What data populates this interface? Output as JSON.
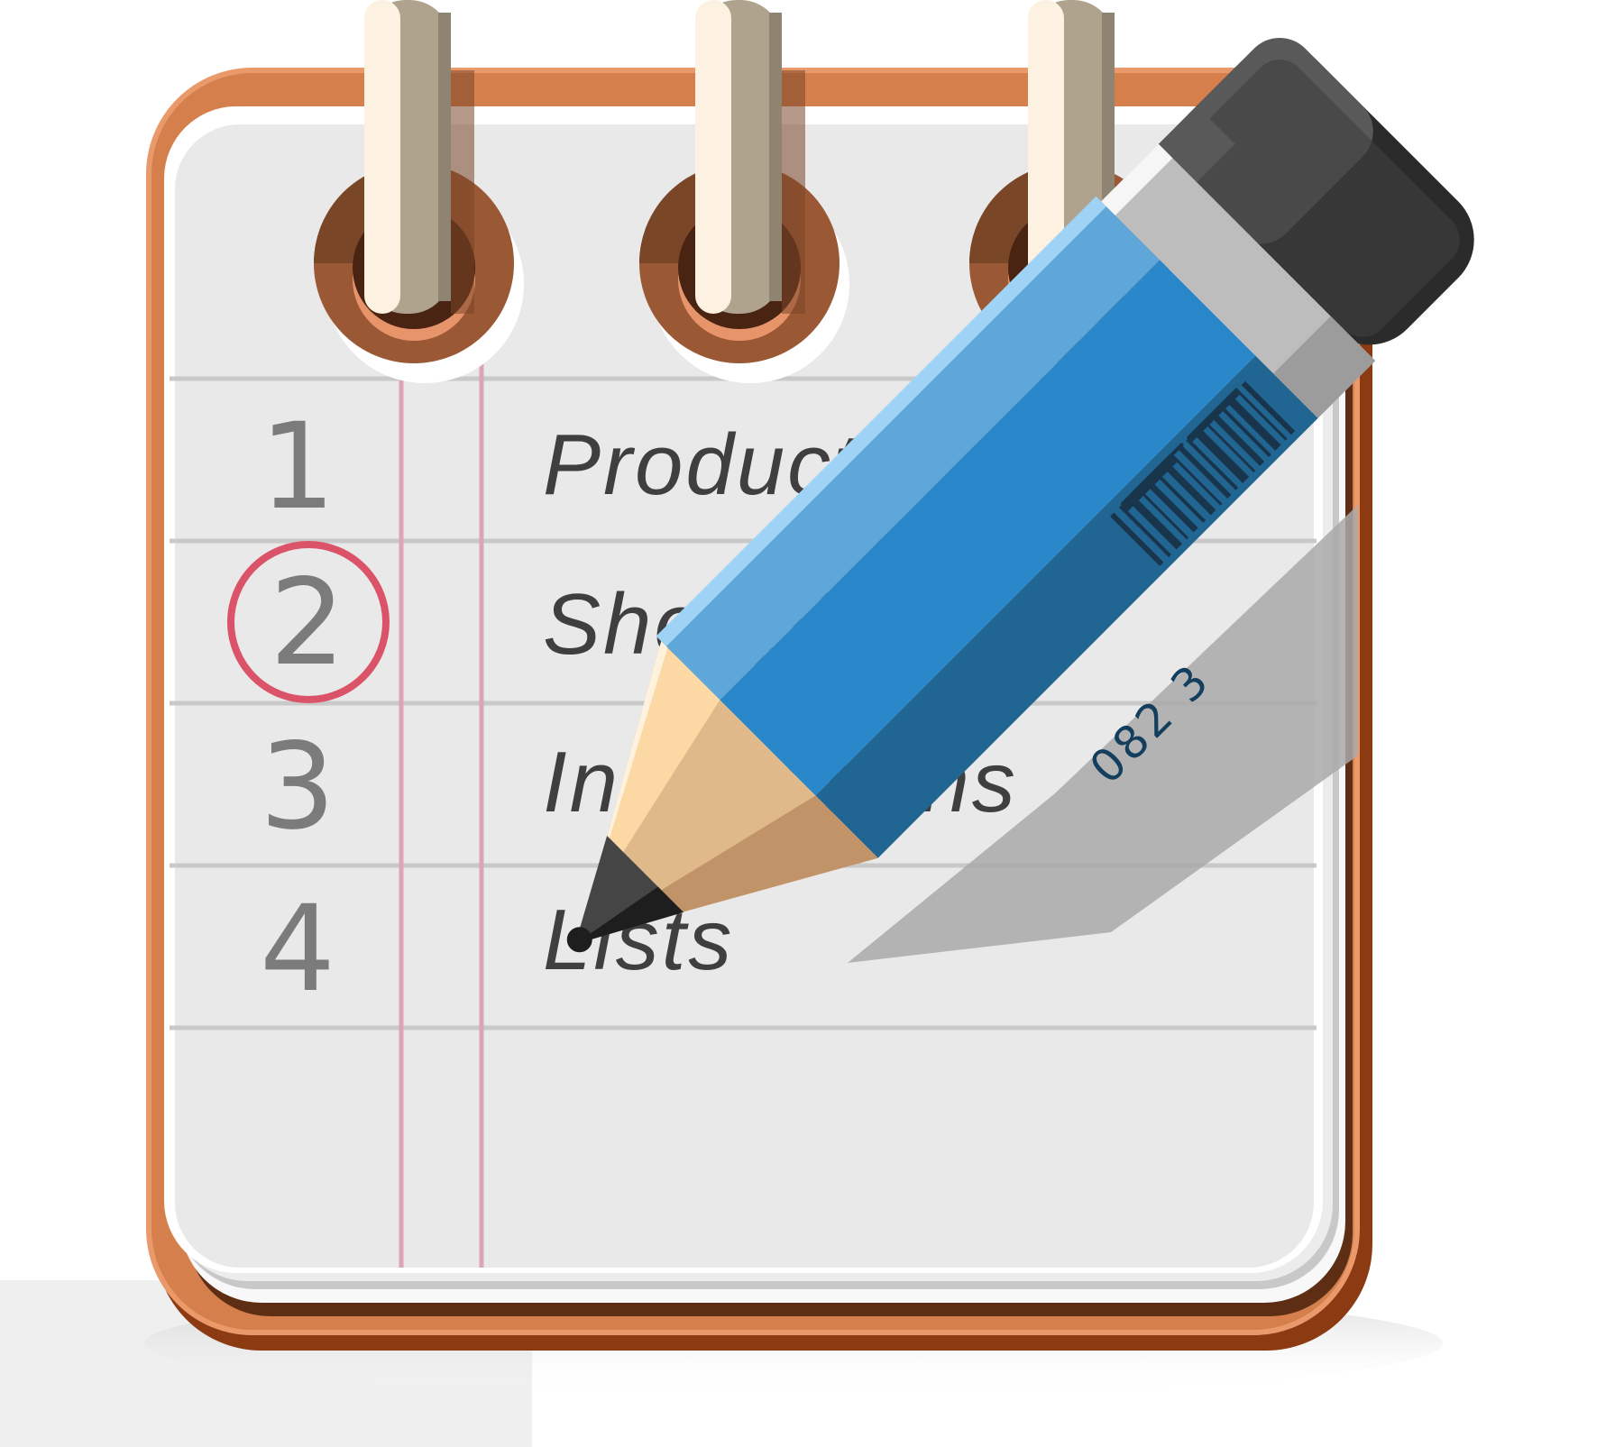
{
  "notepad": {
    "rows": [
      {
        "number": "1",
        "label": "Products",
        "circled": false
      },
      {
        "number": "2",
        "label": "Shopping",
        "circled": true
      },
      {
        "number": "3",
        "label": "Instructions",
        "circled": false
      },
      {
        "number": "4",
        "label": "Lists",
        "circled": false
      }
    ],
    "spiral_ring_count": 3
  },
  "pencil": {
    "code": "082 3"
  },
  "colors": {
    "cover": "#d5804c",
    "cover_dark": "#8c3a12",
    "paper": "#e9e9e9",
    "rule_line": "#c9c9c9",
    "margin_line": "#dba5b7",
    "circle_mark": "#db5368",
    "pencil_body": "#2a88ca",
    "pencil_eraser": "#3f3f3f"
  }
}
